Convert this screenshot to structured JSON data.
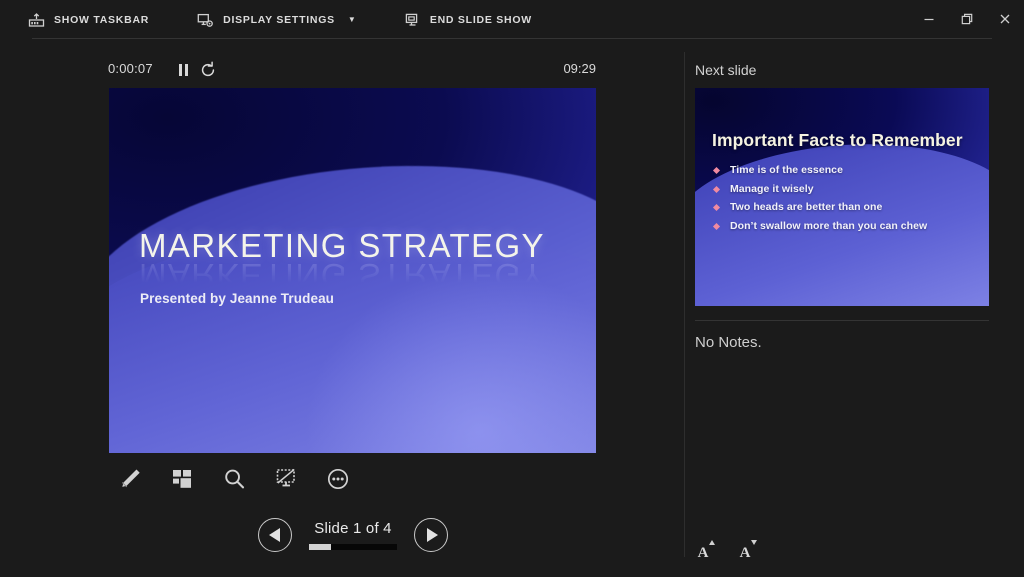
{
  "toolbar": {
    "items": [
      {
        "label": "SHOW TASKBAR",
        "icon": "taskbar-icon",
        "caret": false
      },
      {
        "label": "DISPLAY SETTINGS",
        "icon": "display-settings-icon",
        "caret": true,
        "caret_glyph": "▼"
      },
      {
        "label": "END SLIDE SHOW",
        "icon": "end-slide-show-icon",
        "caret": false
      }
    ],
    "window_controls": [
      {
        "name": "minimize",
        "glyph": "—"
      },
      {
        "name": "restore",
        "glyph": "❐"
      },
      {
        "name": "close",
        "glyph": "✕"
      }
    ]
  },
  "presenter": {
    "timer": "0:00:07",
    "pause_label": "Pause",
    "reset_label": "Restart",
    "clock": "09:29"
  },
  "current_slide": {
    "title": "MARKETING STRATEGY",
    "subtitle": "Presented by Jeanne Trudeau"
  },
  "tools": [
    {
      "name": "pen-icon",
      "label": "Pen and laser pointer tools"
    },
    {
      "name": "all-slides-icon",
      "label": "See all slides"
    },
    {
      "name": "zoom-icon",
      "label": "Zoom into the slide"
    },
    {
      "name": "black-screen-icon",
      "label": "Black or unblack slide show"
    },
    {
      "name": "more-options-icon",
      "label": "More slide show options"
    }
  ],
  "navigation": {
    "previous_label": "Previous slide",
    "next_label": "Next slide",
    "slide_label": "Slide 1 of 4",
    "current": 1,
    "total": 4,
    "progress_percent": 25
  },
  "next_slide": {
    "header": "Next slide",
    "title": "Important Facts to Remember",
    "bullets": [
      "Time is of the essence",
      "Manage it wisely",
      "Two heads are better than one",
      "Don’t swallow more than you can chew"
    ]
  },
  "notes": {
    "text": "No Notes.",
    "increase_font_label": "A",
    "decrease_font_label": "A"
  },
  "colors": {
    "app_background": "#1b1b1b",
    "text_primary": "#d9d9d9",
    "divider": "#343434",
    "slide_dark": "#0a0a50",
    "slide_light": "#8b8fe8",
    "bullet": "#f08aa0",
    "slide_title": "#f4f4ea",
    "progress_fill": "#d3d3d3"
  }
}
